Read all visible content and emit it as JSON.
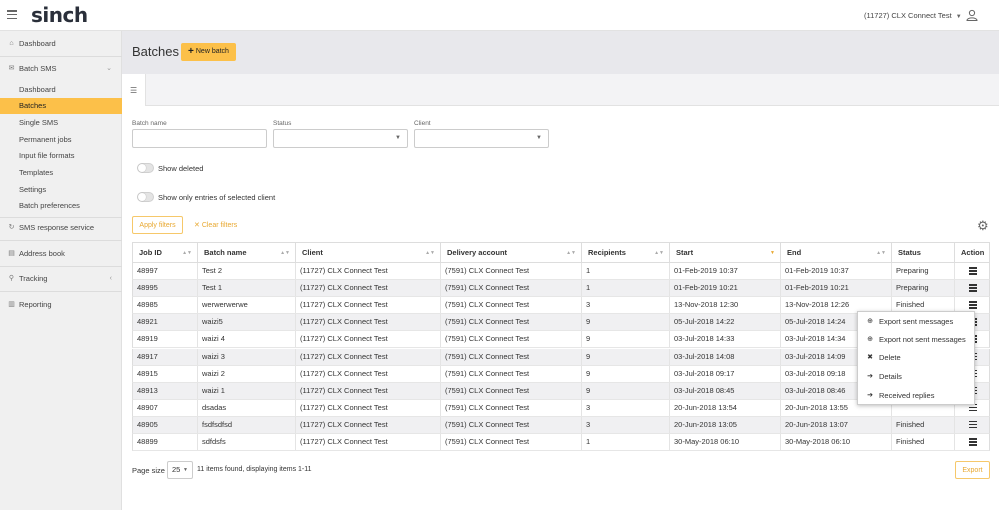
{
  "app": {
    "logo": "sinch",
    "account": "(11727) CLX Connect Test"
  },
  "sidebar": {
    "items": [
      {
        "label": "Dashboard",
        "icon": "home-icon"
      },
      {
        "label": "Batch SMS",
        "icon": "envelope-icon"
      },
      {
        "label": "Dashboard"
      },
      {
        "label": "Batches"
      },
      {
        "label": "Single SMS"
      },
      {
        "label": "Permanent jobs"
      },
      {
        "label": "Input file formats"
      },
      {
        "label": "Templates"
      },
      {
        "label": "Settings"
      },
      {
        "label": "Batch preferences"
      },
      {
        "label": "SMS response service",
        "icon": "reply-icon"
      },
      {
        "label": "Address book",
        "icon": "book-icon"
      },
      {
        "label": "Tracking",
        "icon": "search-icon"
      },
      {
        "label": "Reporting",
        "icon": "chart-icon"
      }
    ]
  },
  "header": {
    "title": "Batches",
    "new_batch_label": "New batch"
  },
  "filters": {
    "batch_name_label": "Batch name",
    "status_label": "Status",
    "client_label": "Client",
    "show_deleted": "Show deleted",
    "show_selected_client": "Show only entries of selected client",
    "apply": "Apply filters",
    "clear": "Clear filters"
  },
  "table": {
    "columns": [
      "Job ID",
      "Batch name",
      "Client",
      "Delivery account",
      "Recipients",
      "Start",
      "End",
      "Status",
      "Action"
    ],
    "rows": [
      [
        "48997",
        "Test 2",
        "(11727) CLX Connect Test",
        "(7591) CLX Connect Test",
        "1",
        "01-Feb-2019 10:37",
        "01-Feb-2019 10:37",
        "Preparing"
      ],
      [
        "48995",
        "Test 1",
        "(11727) CLX Connect Test",
        "(7591) CLX Connect Test",
        "1",
        "01-Feb-2019 10:21",
        "01-Feb-2019 10:21",
        "Preparing"
      ],
      [
        "48985",
        "werwerwerwe",
        "(11727) CLX Connect Test",
        "(7591) CLX Connect Test",
        "3",
        "13-Nov-2018 12:30",
        "13-Nov-2018 12:26",
        "Finished"
      ],
      [
        "48921",
        "waizi5",
        "(11727) CLX Connect Test",
        "(7591) CLX Connect Test",
        "9",
        "05-Jul-2018 14:22",
        "05-Jul-2018 14:24",
        ""
      ],
      [
        "48919",
        "waizi 4",
        "(11727) CLX Connect Test",
        "(7591) CLX Connect Test",
        "9",
        "03-Jul-2018 14:33",
        "03-Jul-2018 14:34",
        ""
      ],
      [
        "48917",
        "waizi 3",
        "(11727) CLX Connect Test",
        "(7591) CLX Connect Test",
        "9",
        "03-Jul-2018 14:08",
        "03-Jul-2018 14:09",
        ""
      ],
      [
        "48915",
        "waizi 2",
        "(11727) CLX Connect Test",
        "(7591) CLX Connect Test",
        "9",
        "03-Jul-2018 09:17",
        "03-Jul-2018 09:18",
        ""
      ],
      [
        "48913",
        "waizi 1",
        "(11727) CLX Connect Test",
        "(7591) CLX Connect Test",
        "9",
        "03-Jul-2018 08:45",
        "03-Jul-2018 08:46",
        ""
      ],
      [
        "48907",
        "dsadas",
        "(11727) CLX Connect Test",
        "(7591) CLX Connect Test",
        "3",
        "20-Jun-2018 13:54",
        "20-Jun-2018 13:55",
        ""
      ],
      [
        "48905",
        "fsdfsdfsd",
        "(11727) CLX Connect Test",
        "(7591) CLX Connect Test",
        "3",
        "20-Jun-2018 13:05",
        "20-Jun-2018 13:07",
        "Finished"
      ],
      [
        "48899",
        "sdfdsfs",
        "(11727) CLX Connect Test",
        "(7591) CLX Connect Test",
        "1",
        "30-May-2018 06:10",
        "30-May-2018 06:10",
        "Finished"
      ]
    ]
  },
  "context_menu": {
    "items": [
      {
        "label": "Export sent messages",
        "icon": "download-icon"
      },
      {
        "label": "Export not sent messages",
        "icon": "download-icon"
      },
      {
        "label": "Delete",
        "icon": "close-icon"
      },
      {
        "label": "Details",
        "icon": "arrow-right-icon"
      },
      {
        "label": "Received replies",
        "icon": "arrow-right-icon"
      }
    ]
  },
  "footer": {
    "page_size_label": "Page size",
    "page_size_value": "25",
    "items_info": "11 items found, displaying items 1-11",
    "export": "Export"
  },
  "colors": {
    "accent": "#fcc049",
    "accent_text": "#e8a830"
  }
}
